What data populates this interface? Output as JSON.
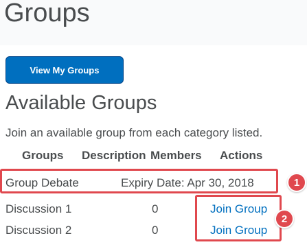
{
  "page": {
    "title": "Groups"
  },
  "toolbar": {
    "view_my_groups_label": "View My Groups"
  },
  "section": {
    "title": "Available Groups",
    "intro": "Join an available group from each category listed."
  },
  "table": {
    "headers": {
      "groups": "Groups",
      "description": "Description",
      "members": "Members",
      "actions": "Actions"
    },
    "category": {
      "name": "Group Debate",
      "expiry": "Expiry Date: Apr 30, 2018"
    },
    "rows": [
      {
        "name": "Discussion 1",
        "members": "0",
        "action": "Join Group"
      },
      {
        "name": "Discussion 2",
        "members": "0",
        "action": "Join Group"
      }
    ]
  },
  "annotations": {
    "callout_1": "1",
    "callout_2": "2",
    "color": "#e0484e"
  },
  "colors": {
    "accent": "#006fbf",
    "text": "#494c4e"
  }
}
